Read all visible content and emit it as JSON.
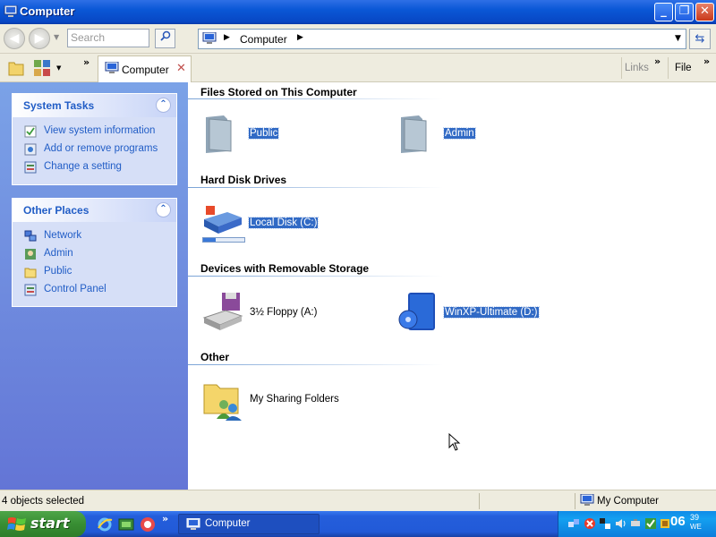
{
  "window": {
    "title": "Computer"
  },
  "navbar": {
    "search_placeholder": "Search",
    "address_crumb": "Computer",
    "back_icon": "back-arrow-icon",
    "forward_icon": "forward-arrow-icon"
  },
  "toolbar": {
    "tab_label": "Computer",
    "links_label": "Links",
    "file_label": "File",
    "more_chevron": "»"
  },
  "system_tasks": {
    "title": "System Tasks",
    "items": [
      {
        "label": "View system information",
        "icon": "checklist-icon"
      },
      {
        "label": "Add or remove programs",
        "icon": "programs-icon"
      },
      {
        "label": "Change a setting",
        "icon": "control-panel-icon"
      }
    ]
  },
  "other_places": {
    "title": "Other Places",
    "items": [
      {
        "label": "Network",
        "icon": "network-icon"
      },
      {
        "label": "Admin",
        "icon": "user-folder-icon"
      },
      {
        "label": "Public",
        "icon": "folder-icon"
      },
      {
        "label": "Control Panel",
        "icon": "control-panel-icon"
      }
    ]
  },
  "main": {
    "groups": [
      {
        "title": "Files Stored on This Computer",
        "items": [
          {
            "label": "Public",
            "selected": true
          },
          {
            "label": "Admin",
            "selected": true
          }
        ]
      },
      {
        "title": "Hard Disk Drives",
        "items": [
          {
            "label": "Local Disk (C:)",
            "selected": true,
            "usage_fraction": 0.3
          }
        ]
      },
      {
        "title": "Devices with Removable Storage",
        "items": [
          {
            "label": "3½ Floppy (A:)",
            "selected": false
          },
          {
            "label": "WinXP-Ultimate (D:)",
            "selected": true
          }
        ]
      },
      {
        "title": "Other",
        "items": [
          {
            "label": "My Sharing Folders",
            "selected": false
          }
        ]
      }
    ]
  },
  "statusbar": {
    "left": "4 objects selected",
    "right": "My Computer"
  },
  "taskbar": {
    "start_label": "start",
    "task_label": "Computer",
    "clock_hm": "06",
    "clock_min": "39",
    "clock_day": "WE",
    "quick_chevron": "»"
  },
  "colors": {
    "selection": "#316ac5",
    "link": "#215dc6",
    "taskbar": "#245edb",
    "start": "#388e33"
  }
}
